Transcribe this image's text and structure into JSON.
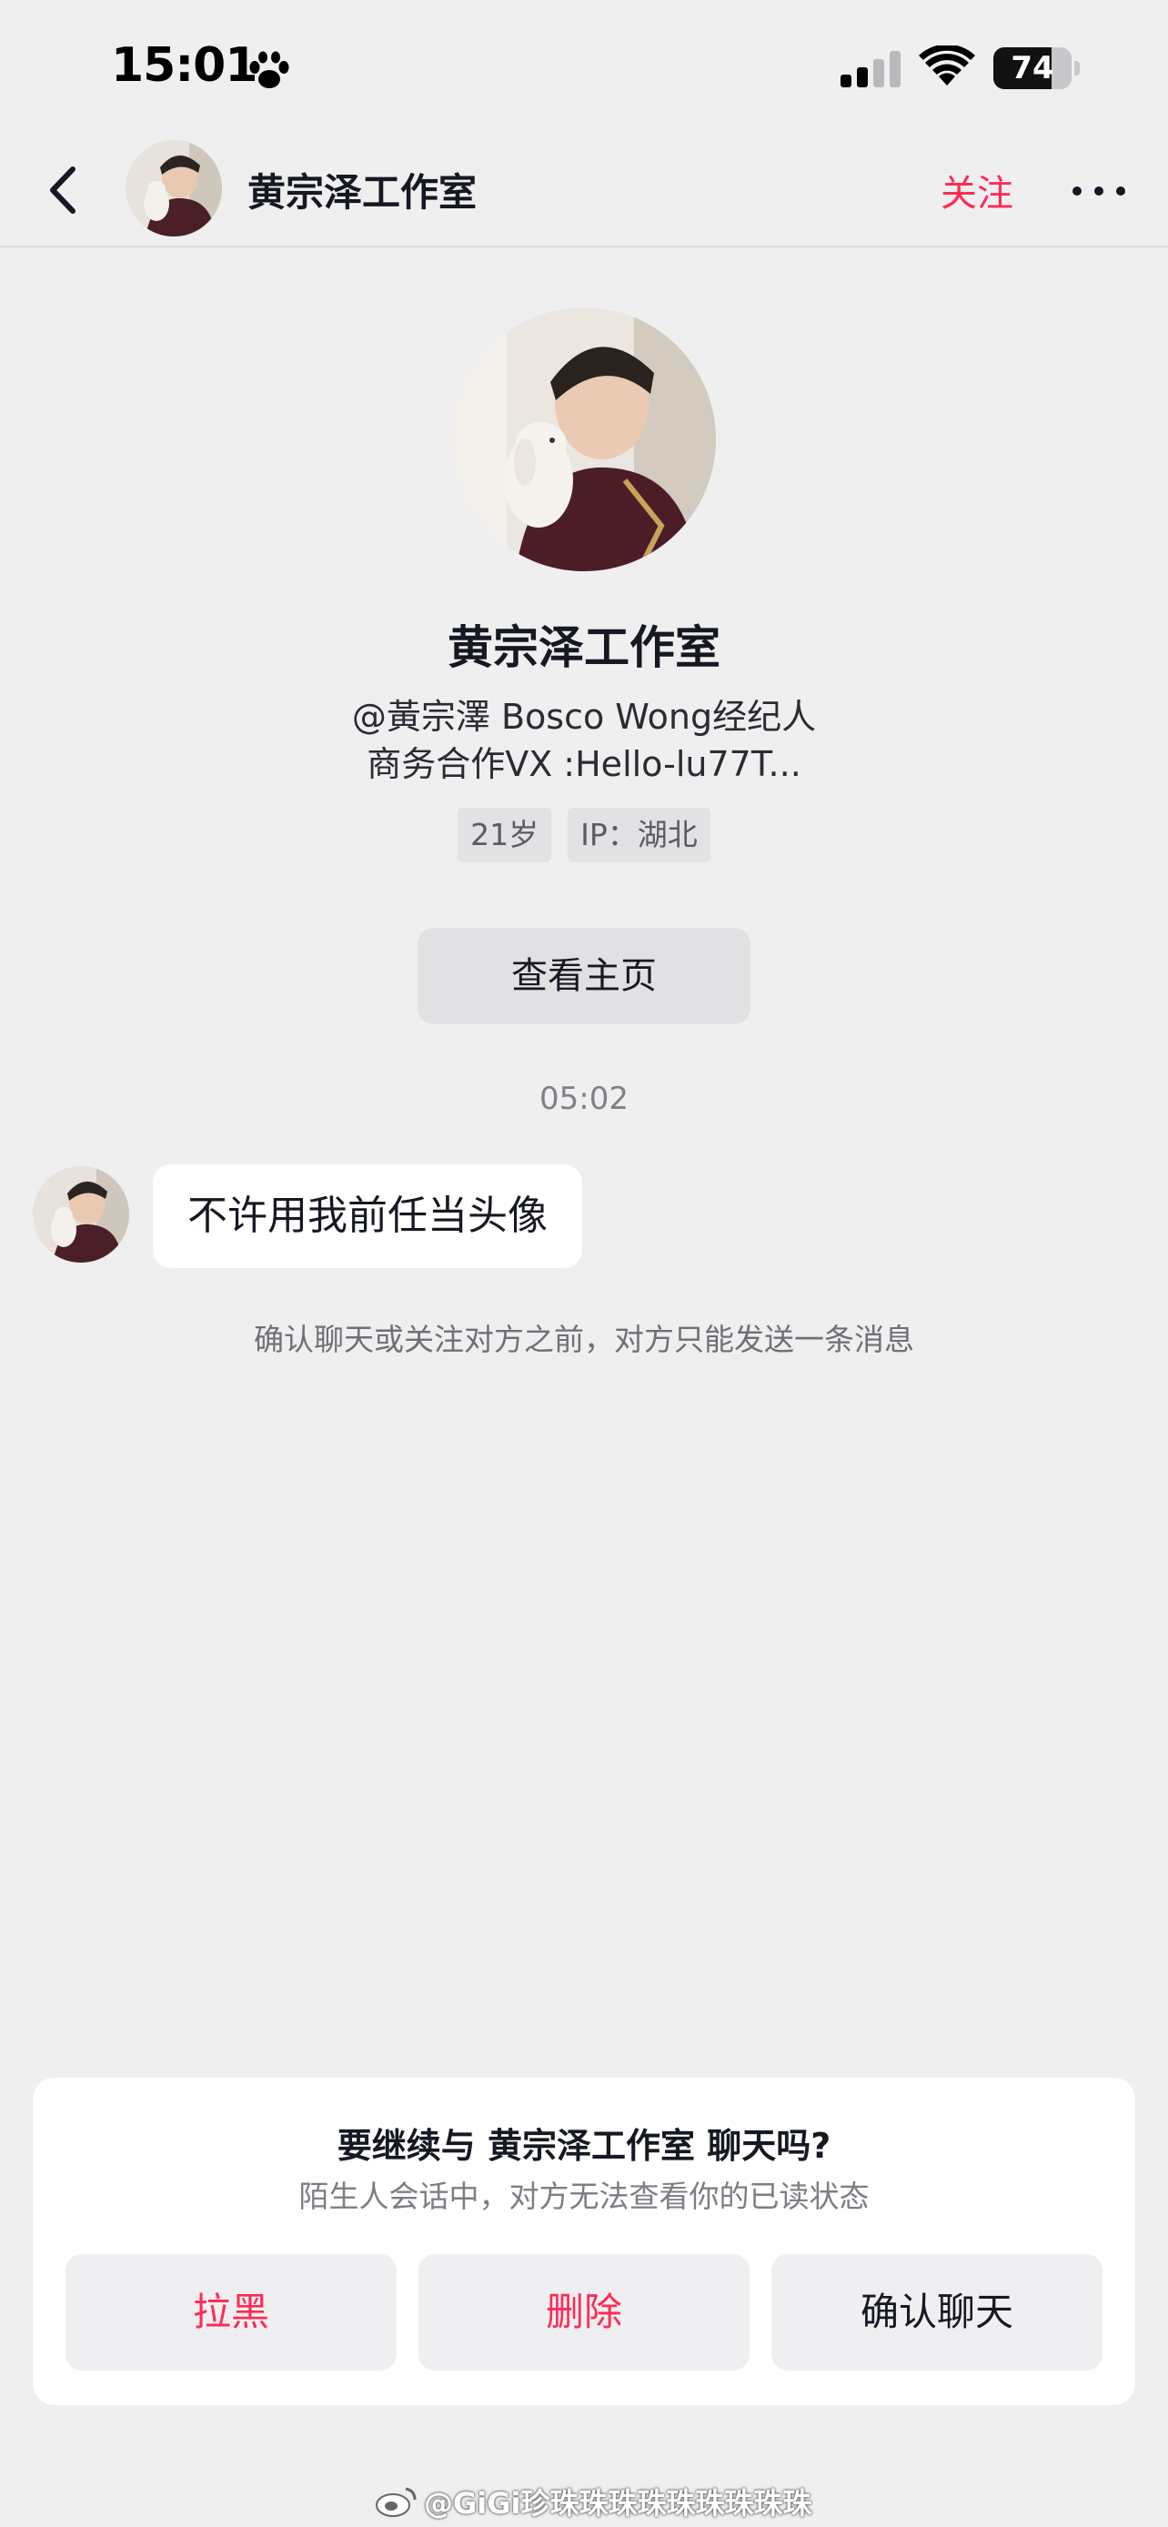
{
  "status_bar": {
    "time": "15:01",
    "battery_percent": 74,
    "battery_label": "74",
    "icons": [
      "paw-icon",
      "cellular-signal-icon",
      "wifi-icon",
      "battery-icon"
    ]
  },
  "header": {
    "back_icon": "chevron-left-icon",
    "title": "黄宗泽工作室",
    "follow_label": "关注",
    "more_icon": "more-horizontal-icon"
  },
  "profile": {
    "name": "黄宗泽工作室",
    "bio_line1": "@黃宗澤 Bosco Wong经纪人",
    "bio_line2": "商务合作VX :Hello-lu77T...",
    "tags": [
      "21岁",
      "IP：湖北"
    ],
    "view_home_label": "查看主页"
  },
  "chat": {
    "timestamp": "05:02",
    "messages": [
      {
        "text": "不许用我前任当头像"
      }
    ],
    "notice": "确认聊天或关注对方之前，对方只能发送一条消息"
  },
  "dialog": {
    "title": "要继续与 黄宗泽工作室 聊天吗?",
    "subtitle": "陌生人会话中，对方无法查看你的已读状态",
    "block_label": "拉黑",
    "delete_label": "删除",
    "confirm_label": "确认聊天"
  },
  "watermark": {
    "text": "@GiGi珍珠珠珠珠珠珠珠珠珠"
  },
  "colors": {
    "accent_red": "#fe2c55",
    "background": "#efeff0",
    "text_primary": "#161823"
  }
}
